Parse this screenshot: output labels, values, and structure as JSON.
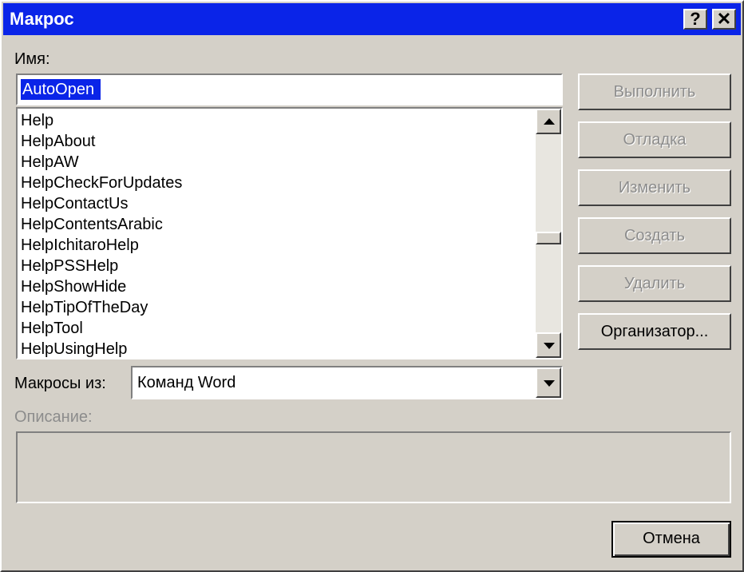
{
  "window": {
    "title": "Макрос",
    "help_glyph": "?",
    "close_glyph": "✕"
  },
  "name_label": "Имя:",
  "name_value": "AutoOpen",
  "macros": [
    "Help",
    "HelpAbout",
    "HelpAW",
    "HelpCheckForUpdates",
    "HelpContactUs",
    "HelpContentsArabic",
    "HelpIchitaroHelp",
    "HelpPSSHelp",
    "HelpShowHide",
    "HelpTipOfTheDay",
    "HelpTool",
    "HelpUsingHelp"
  ],
  "macros_from_label": "Макросы из:",
  "macros_from_value": "Команд Word",
  "description_label": "Описание:",
  "description_text": "",
  "buttons": {
    "run": "Выполнить",
    "step_into": "Отладка",
    "edit": "Изменить",
    "create": "Создать",
    "delete": "Удалить",
    "organizer": "Организатор...",
    "cancel": "Отмена"
  },
  "colors": {
    "titlebar": "#0a24e8",
    "face": "#d4d0c8",
    "selection": "#0a24e8"
  },
  "icons": {
    "help": "help-icon",
    "close": "close-icon",
    "scroll_up": "arrow-up-icon",
    "scroll_down": "arrow-down-icon",
    "dropdown": "chevron-down-icon"
  }
}
